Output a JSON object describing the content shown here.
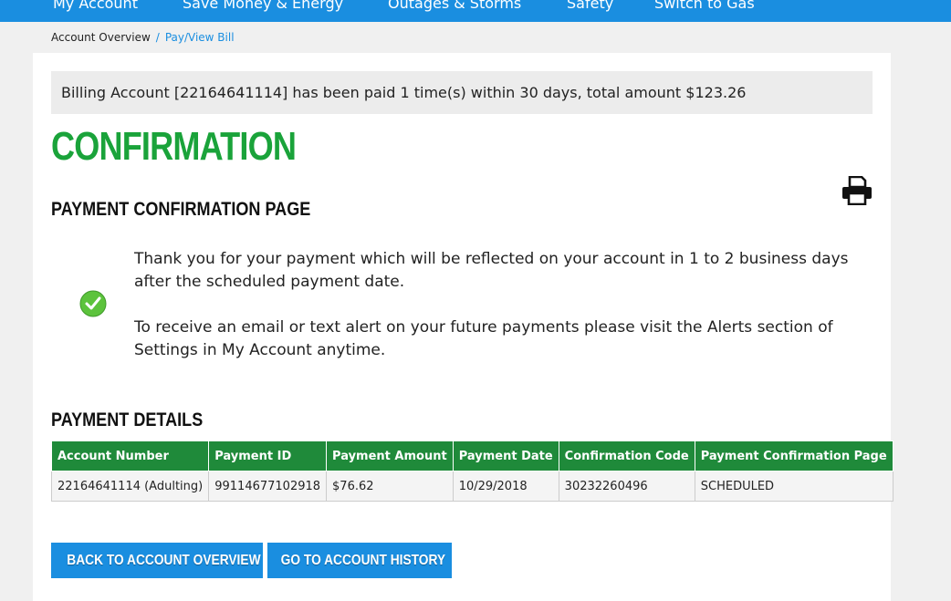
{
  "nav": {
    "items": [
      {
        "label": "My Account"
      },
      {
        "label": "Save Money & Energy"
      },
      {
        "label": "Outages & Storms"
      },
      {
        "label": "Safety"
      },
      {
        "label": "Switch to Gas"
      }
    ]
  },
  "breadcrumb": {
    "root": "Account Overview",
    "separator": "/",
    "current": "Pay/View Bill"
  },
  "notice": "Billing Account [22164641114] has been paid 1 time(s) within 30 days, total amount $123.26",
  "confirmation_title": "CONFIRMATION",
  "payment_confirmation_heading": "PAYMENT CONFIRMATION PAGE",
  "messages": {
    "thank_you": "Thank you for your payment which will be reflected on your account in 1 to 2 business days after the scheduled payment date.",
    "alerts": "To receive an email or text alert on your future payments please visit the Alerts section of Settings in My Account anytime."
  },
  "payment_details_heading": "PAYMENT DETAILS",
  "table": {
    "headers": [
      "Account Number",
      "Payment ID",
      "Payment Amount",
      "Payment Date",
      "Confirmation Code",
      "Payment Confirmation Page"
    ],
    "rows": [
      [
        "22164641114 (Adulting)",
        "99114677102918",
        "$76.62",
        "10/29/2018",
        "30232260496",
        "SCHEDULED"
      ]
    ]
  },
  "buttons": {
    "back": "BACK TO ACCOUNT OVERVIEW",
    "history": "GO TO ACCOUNT HISTORY"
  },
  "icons": {
    "print": "print-icon",
    "check": "check-icon"
  },
  "colors": {
    "brand_blue": "#1a8ee0",
    "confirmation_green": "#1aa33a",
    "table_header_green": "#1f8a3a"
  }
}
